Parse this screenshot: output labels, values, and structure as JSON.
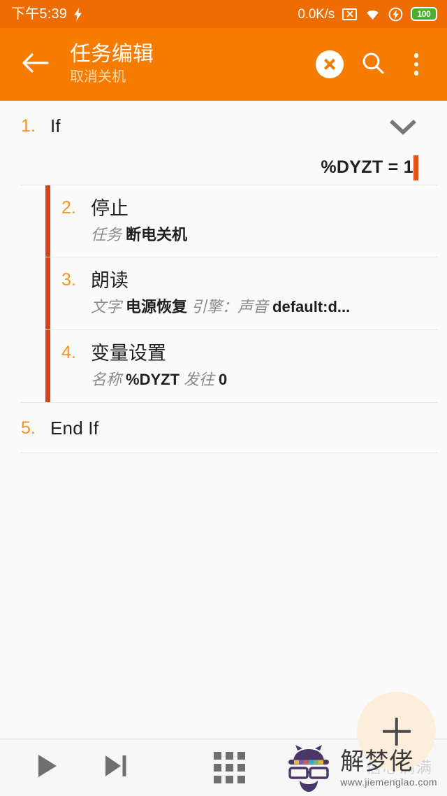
{
  "status_bar": {
    "clock": "下午5:39",
    "charging_icon": "bolt-icon",
    "network_speed": "0.0K/s",
    "no_sim_icon": "no-sim-icon",
    "wifi_icon": "wifi-icon",
    "flash_icon": "flash-circle-icon",
    "battery_level": "100",
    "battery_color": "#4caf2f",
    "background": "#ef6c00"
  },
  "app_bar": {
    "back_icon": "back-arrow-icon",
    "title": "任务编辑",
    "subtitle": "取消关机",
    "close_icon": "close-circle-icon",
    "search_icon": "search-icon",
    "overflow_icon": "overflow-menu-icon",
    "background": "#f57c00",
    "subtitle_color": "#ffd9ad"
  },
  "theme": {
    "accent_orange": "#f57c00",
    "number_orange": "#f39423",
    "indent_bar": "#d8431a",
    "condition_marker": "#e2521b",
    "page_background": "#fafafa",
    "divider": "#e6e6e6"
  },
  "actions": [
    {
      "number": "1.",
      "title": "If",
      "indent": 0,
      "has_chevron": true,
      "chevron_icon": "chevron-down-icon",
      "condition": "%DYZT = 1",
      "sub_parts": []
    },
    {
      "number": "2.",
      "title": "停止",
      "indent": 1,
      "has_chevron": false,
      "sub_parts": [
        {
          "label": "任务",
          "value": "断电关机"
        }
      ]
    },
    {
      "number": "3.",
      "title": "朗读",
      "indent": 1,
      "has_chevron": false,
      "sub_parts": [
        {
          "label": "文字",
          "value": "电源恢复"
        },
        {
          "label": "引擎：声音",
          "value": "default:d..."
        }
      ]
    },
    {
      "number": "4.",
      "title": "变量设置",
      "indent": 1,
      "has_chevron": false,
      "sub_parts": [
        {
          "label": "名称",
          "value": "%DYZT"
        },
        {
          "label": "发往",
          "value": "0"
        }
      ]
    },
    {
      "number": "5.",
      "title": "End If",
      "indent": 0,
      "has_chevron": false,
      "sub_parts": []
    }
  ],
  "fab": {
    "icon": "plus-icon",
    "background": "#fbeedb"
  },
  "bottom_bar": {
    "play_icon": "play-icon",
    "step_icon": "play-to-end-icon",
    "grid_icon": "grid-3x3-icon"
  },
  "watermark": {
    "logo_icon": "cat-hat-glasses-logo",
    "brand": "解梦佬",
    "url": "www.jiemenglao.com",
    "ghost_text": "信心满满"
  }
}
